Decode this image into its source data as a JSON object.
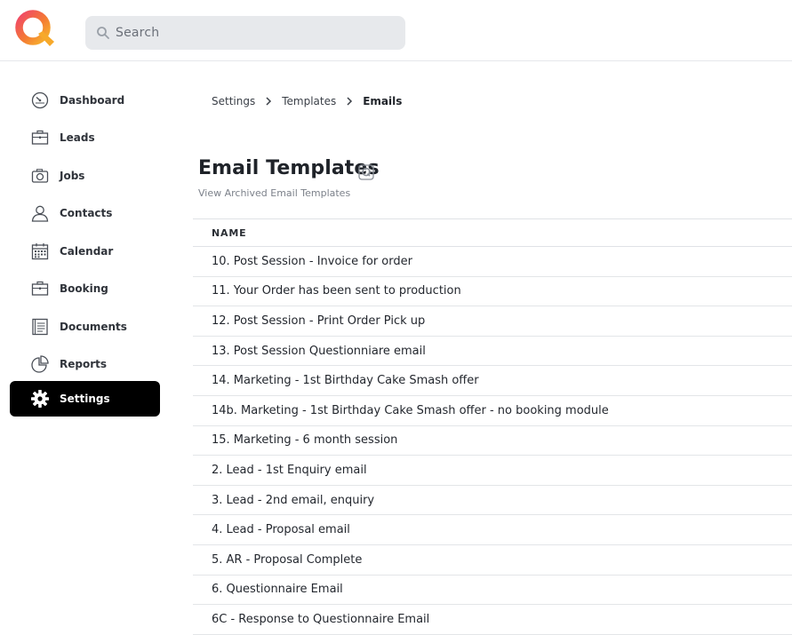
{
  "search": {
    "placeholder": "Search"
  },
  "sidebar": {
    "items": [
      {
        "label": "Dashboard",
        "icon": "dashboard-gauge-icon"
      },
      {
        "label": "Leads",
        "icon": "briefcase-icon"
      },
      {
        "label": "Jobs",
        "icon": "camera-icon"
      },
      {
        "label": "Contacts",
        "icon": "person-icon"
      },
      {
        "label": "Calendar",
        "icon": "calendar-icon"
      },
      {
        "label": "Booking",
        "icon": "briefcase-icon"
      },
      {
        "label": "Documents",
        "icon": "document-icon"
      },
      {
        "label": "Reports",
        "icon": "pie-chart-icon"
      },
      {
        "label": "Settings",
        "icon": "gear-icon",
        "active": true
      }
    ]
  },
  "breadcrumb": {
    "items": [
      "Settings",
      "Templates",
      "Emails"
    ]
  },
  "page": {
    "title": "Email Templates",
    "archived_link": "View Archived Email Templates"
  },
  "table": {
    "header": "NAME",
    "rows": [
      "10. Post Session - Invoice for order",
      "11. Your Order has been sent to production",
      "12. Post Session - Print Order Pick up",
      "13. Post Session Questionniare email",
      "14. Marketing - 1st Birthday Cake Smash offer",
      "14b. Marketing - 1st Birthday Cake Smash offer - no booking module",
      "15. Marketing - 6 month session",
      "2. Lead - 1st Enquiry email",
      "3. Lead - 2nd email, enquiry",
      "4. Lead - Proposal email",
      "5. AR - Proposal Complete",
      "6. Questionnaire Email",
      "6C - Response to Questionnaire Email"
    ]
  },
  "colors": {
    "brand_gradient": [
      "#f0466a",
      "#f58a2c",
      "#f7b52b"
    ],
    "active_nav_bg": "#000000",
    "search_bg": "#e7e9ec"
  }
}
